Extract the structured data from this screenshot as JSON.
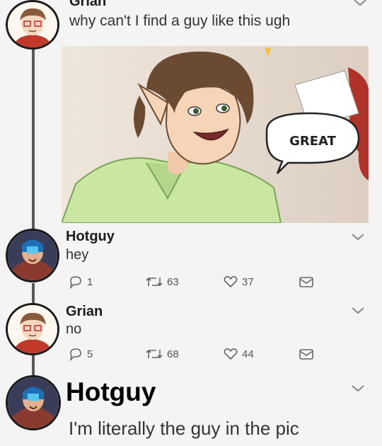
{
  "thread": [
    {
      "author": "Grian",
      "text": "why can't I find a guy like this ugh",
      "image": {
        "speech_bubble": "GREAT"
      }
    },
    {
      "author": "Hotguy",
      "text": "hey",
      "stats": {
        "replies": "1",
        "retweets": "63",
        "likes": "37"
      }
    },
    {
      "author": "Grian",
      "text": "no",
      "stats": {
        "replies": "5",
        "retweets": "68",
        "likes": "44"
      }
    },
    {
      "author": "Hotguy",
      "text": "I'm literally the guy in the pic"
    }
  ],
  "icons": {
    "chevron": "chevron-down-icon",
    "reply": "reply-icon",
    "retweet": "retweet-icon",
    "like": "heart-icon",
    "dm": "mail-icon"
  },
  "colors": {
    "background": "#f4f4f4",
    "text": "#1c1c1c",
    "muted": "#555555",
    "shirt_green": "#c9e7a1",
    "hair_brown": "#6b4a32"
  }
}
